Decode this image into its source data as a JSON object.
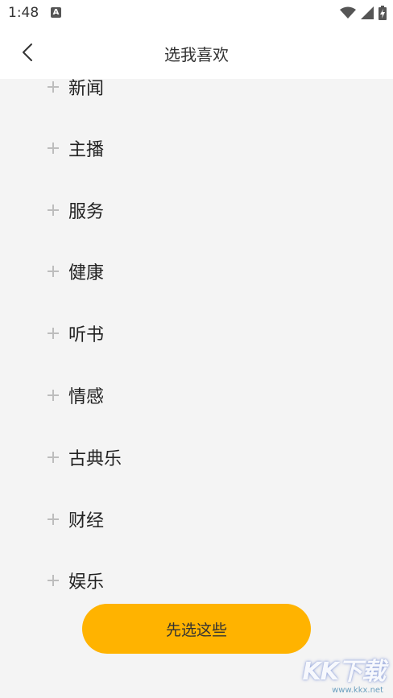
{
  "status_bar": {
    "time": "1:48",
    "notification_icon": "a-icon",
    "icons": [
      "wifi-icon",
      "signal-icon",
      "battery-icon"
    ]
  },
  "header": {
    "title": "选我喜欢",
    "back_icon": "chevron-left-icon"
  },
  "list": {
    "items": [
      {
        "label": "新闻"
      },
      {
        "label": "主播"
      },
      {
        "label": "服务"
      },
      {
        "label": "健康"
      },
      {
        "label": "听书"
      },
      {
        "label": "情感"
      },
      {
        "label": "古典乐"
      },
      {
        "label": "财经"
      },
      {
        "label": "娱乐"
      }
    ]
  },
  "footer": {
    "confirm_label": "先选这些"
  },
  "watermark": {
    "logo": "KK下载",
    "url": "www.kkx.net"
  },
  "colors": {
    "accent": "#ffb300",
    "background": "#f4f4f4",
    "header_bg": "#ffffff"
  }
}
